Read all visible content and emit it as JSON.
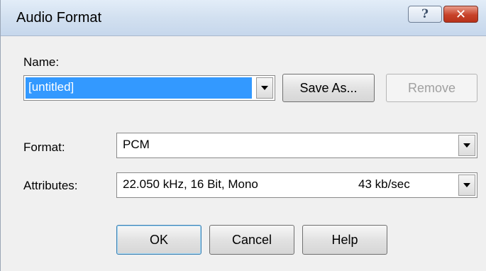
{
  "window": {
    "title": "Audio Format",
    "help_glyph": "?",
    "close_glyph": "✕"
  },
  "name": {
    "label": "Name:",
    "value": "[untitled]"
  },
  "buttons": {
    "save_as": "Save As...",
    "remove": "Remove",
    "ok": "OK",
    "cancel": "Cancel",
    "help": "Help"
  },
  "format": {
    "label": "Format:",
    "value": "PCM"
  },
  "attributes": {
    "label": "Attributes:",
    "value": "22.050 kHz, 16 Bit, Mono",
    "rate": "43 kb/sec"
  },
  "colors": {
    "selection": "#3399ff",
    "dialog_bg": "#f0f0f0",
    "close_button": "#c7422a"
  }
}
